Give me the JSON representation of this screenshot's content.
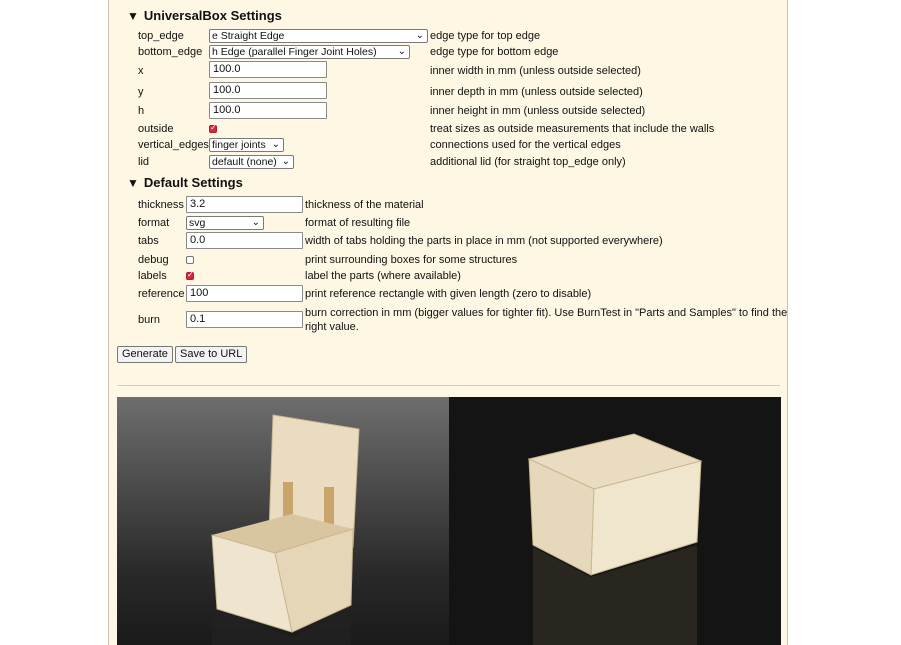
{
  "universalbox": {
    "heading": "UniversalBox Settings",
    "rows": {
      "top_edge": {
        "label": "top_edge",
        "value": "e Straight Edge",
        "desc": "edge type for top edge"
      },
      "bottom_edge": {
        "label": "bottom_edge",
        "value": "h Edge (parallel Finger Joint Holes)",
        "desc": "edge type for bottom edge"
      },
      "x": {
        "label": "x",
        "value": "100.0",
        "desc": "inner width in mm (unless outside selected)"
      },
      "y": {
        "label": "y",
        "value": "100.0",
        "desc": "inner depth in mm (unless outside selected)"
      },
      "h": {
        "label": "h",
        "value": "100.0",
        "desc": "inner height in mm (unless outside selected)"
      },
      "outside": {
        "label": "outside",
        "checked": true,
        "desc": "treat sizes as outside measurements that include the walls"
      },
      "vertical_edges": {
        "label": "vertical_edges",
        "value": "finger joints",
        "desc": "connections used for the vertical edges"
      },
      "lid": {
        "label": "lid",
        "value": "default (none)",
        "desc": "additional lid (for straight top_edge only)"
      }
    }
  },
  "defaults": {
    "heading": "Default Settings",
    "rows": {
      "thickness": {
        "label": "thickness",
        "value": "3.2",
        "desc": "thickness of the material"
      },
      "format": {
        "label": "format",
        "value": "svg",
        "desc": "format of resulting file"
      },
      "tabs": {
        "label": "tabs",
        "value": "0.0",
        "desc": "width of tabs holding the parts in place in mm (not supported everywhere)"
      },
      "debug": {
        "label": "debug",
        "checked": false,
        "desc": "print surrounding boxes for some structures"
      },
      "labels": {
        "label": "labels",
        "checked": true,
        "desc": "label the parts (where available)"
      },
      "reference": {
        "label": "reference",
        "value": "100",
        "desc": "print reference rectangle with given length (zero to disable)"
      },
      "burn": {
        "label": "burn",
        "value": "0.1",
        "desc_line1": "burn correction in mm (bigger values for tighter fit). Use BurnTest in \"Parts and Samples\" to find the",
        "desc_line2": "right value."
      }
    }
  },
  "buttons": {
    "generate": "Generate",
    "save_url": "Save to URL"
  },
  "icons": {
    "expand": "triangle-down-icon",
    "dropdown": "chevron-down-icon",
    "check": "checkmark-icon"
  },
  "colors": {
    "panel_bg": "#fdf7e4",
    "checkbox_checked": "#d7263d"
  }
}
